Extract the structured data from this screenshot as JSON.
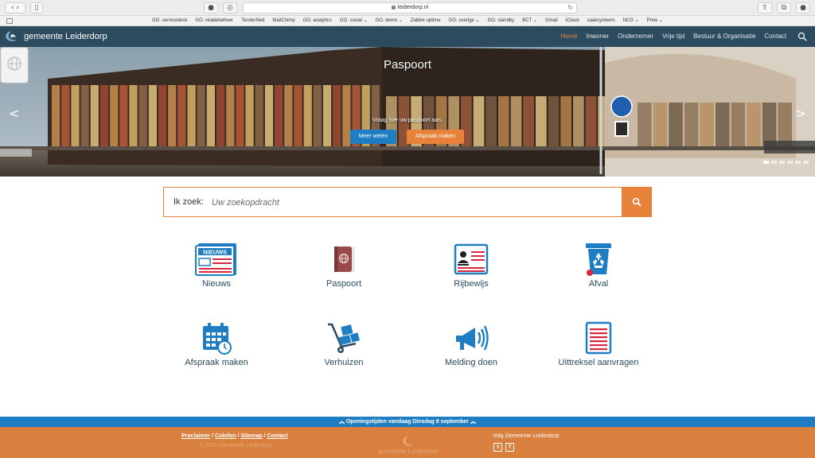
{
  "browser": {
    "url": "leiderdorp.nl",
    "bookmarks": [
      "GO. servicedesk",
      "GO. relatiebeheer",
      "TenderNed",
      "MailChimp",
      "GO. analytics",
      "GO. social ⌄",
      "GO. demo ⌄",
      "Zabbix uptime",
      "GO. overige ⌄",
      "GO. standby",
      "BCT ⌄",
      "Gmail",
      "iCloud",
      "zaaksysteem",
      "NCG ⌄",
      "Prive ⌄"
    ]
  },
  "nav": {
    "brand": "gemeente Leiderdorp",
    "items": [
      "Home",
      "Inwoner",
      "Ondernemer",
      "Vrije tijd",
      "Bestuur & Organisatie",
      "Contact"
    ],
    "active_index": 0
  },
  "hero": {
    "title": "Paspoort",
    "subtitle": "Vraag hier uw paspoort aan.",
    "primary_button": "Meer weten",
    "secondary_button": "Afspraak maken",
    "prev_arrow": "<",
    "next_arrow": ">"
  },
  "search": {
    "label": "Ik zoek:",
    "placeholder": "Uw zoekopdracht"
  },
  "tiles": [
    {
      "label": "Nieuws",
      "icon": "newspaper-icon",
      "badge": "NIEUWS"
    },
    {
      "label": "Paspoort",
      "icon": "passport-icon"
    },
    {
      "label": "Rijbewijs",
      "icon": "driving-license-icon"
    },
    {
      "label": "Afval",
      "icon": "recycle-bin-icon"
    },
    {
      "label": "Afspraak maken",
      "icon": "calendar-clock-icon"
    },
    {
      "label": "Verhuizen",
      "icon": "hand-truck-icon"
    },
    {
      "label": "Melding doen",
      "icon": "megaphone-icon"
    },
    {
      "label": "Uittreksel aanvragen",
      "icon": "document-icon"
    }
  ],
  "opening_bar": "︽ Openingstijden vandaag Dinsdag 8 september ︽",
  "footer": {
    "links": [
      "Proclaimer",
      "Colofon",
      "Sitemap",
      "Contact"
    ],
    "link_separator": " / ",
    "copyright": "© 2015 Gemeente Leiderdorp",
    "logo_text": "gemeente Leiderdorp",
    "follow": "Volg Gemeente Leiderdorp",
    "social": [
      "t",
      "f"
    ]
  },
  "colors": {
    "nav_bg": "#2c4b5e",
    "accent_orange": "#e8823b",
    "accent_blue": "#1f7ec3",
    "footer_bg": "#d9803f",
    "icon_blue": "#1f7ec3",
    "icon_red": "#d7263d"
  }
}
